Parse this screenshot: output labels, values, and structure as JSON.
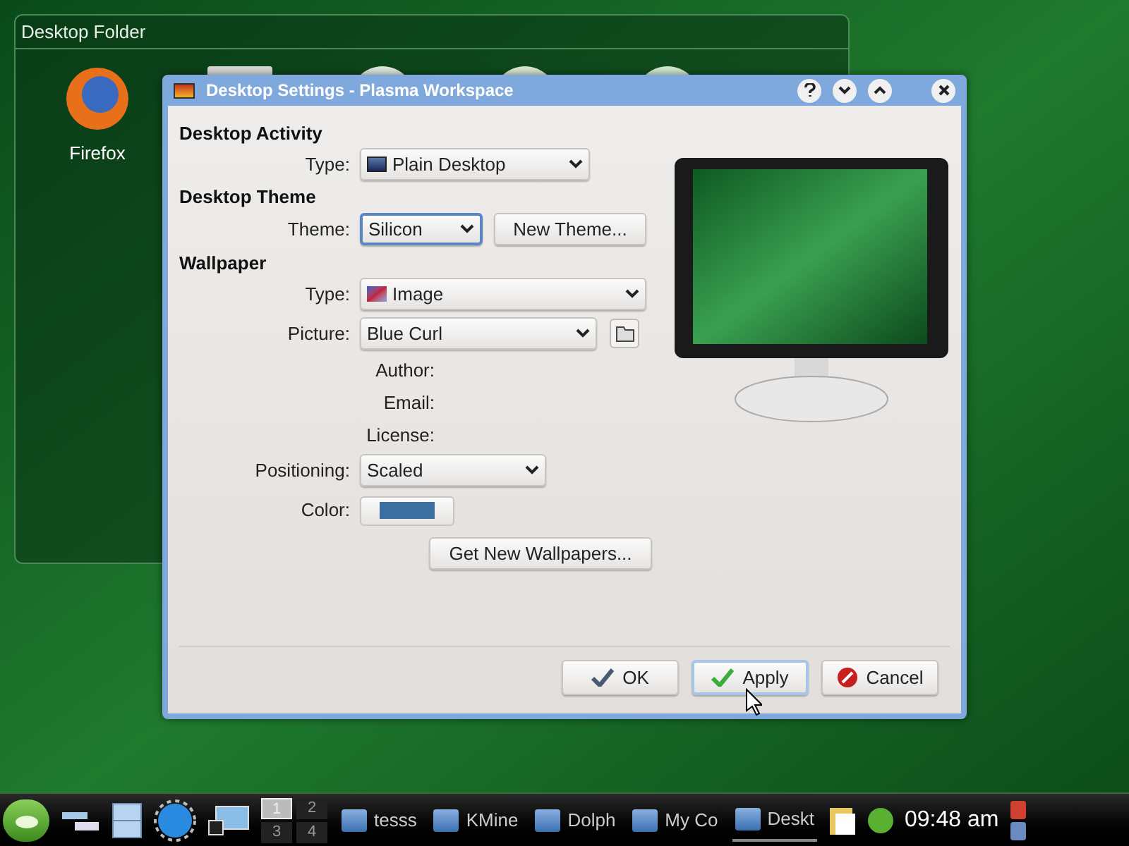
{
  "desktop_folder": {
    "title": "Desktop Folder",
    "items": [
      {
        "label": "Firefox"
      }
    ]
  },
  "dialog": {
    "title": "Desktop Settings - Plasma Workspace",
    "sections": [
      {
        "heading": "Desktop Activity",
        "rows": [
          {
            "kind": "combo",
            "label": "Type:",
            "value": "Plain Desktop"
          }
        ]
      },
      {
        "heading": "Desktop Theme",
        "rows": [
          {
            "kind": "combo_button",
            "label": "Theme:",
            "value": "Silicon",
            "focused": true,
            "button": "New Theme..."
          }
        ]
      },
      {
        "heading": "Wallpaper",
        "rows": [
          {
            "kind": "combo",
            "label": "Type:",
            "value": "Image"
          },
          {
            "kind": "combo_browse",
            "label": "Picture:",
            "value": "Blue Curl"
          },
          {
            "kind": "info",
            "label": "Author:"
          },
          {
            "kind": "info",
            "label": "Email:"
          },
          {
            "kind": "info",
            "label": "License:"
          },
          {
            "kind": "combo",
            "label": "Positioning:",
            "value": "Scaled"
          },
          {
            "kind": "color",
            "label": "Color:",
            "color": "#3a6fa0"
          },
          {
            "kind": "button",
            "label": "Get New Wallpapers..."
          }
        ]
      }
    ],
    "buttons": [
      {
        "label": "OK",
        "kind": "ok",
        "focused": false
      },
      {
        "label": "Apply",
        "kind": "apply",
        "focused": true
      },
      {
        "label": "Cancel",
        "kind": "cancel",
        "focused": false
      }
    ]
  },
  "taskbar": {
    "pager": [
      {
        "label": "1",
        "selected": true
      },
      {
        "label": "2",
        "selected": false
      },
      {
        "label": "3",
        "selected": false
      },
      {
        "label": "4",
        "selected": false
      }
    ],
    "tasks": [
      {
        "label": "tesss",
        "selected": false
      },
      {
        "label": "KMine",
        "selected": false
      },
      {
        "label": "Dolph",
        "selected": false
      },
      {
        "label": "My Co",
        "selected": false
      },
      {
        "label": "Deskt",
        "selected": true
      }
    ],
    "clock": "09:48 am"
  }
}
